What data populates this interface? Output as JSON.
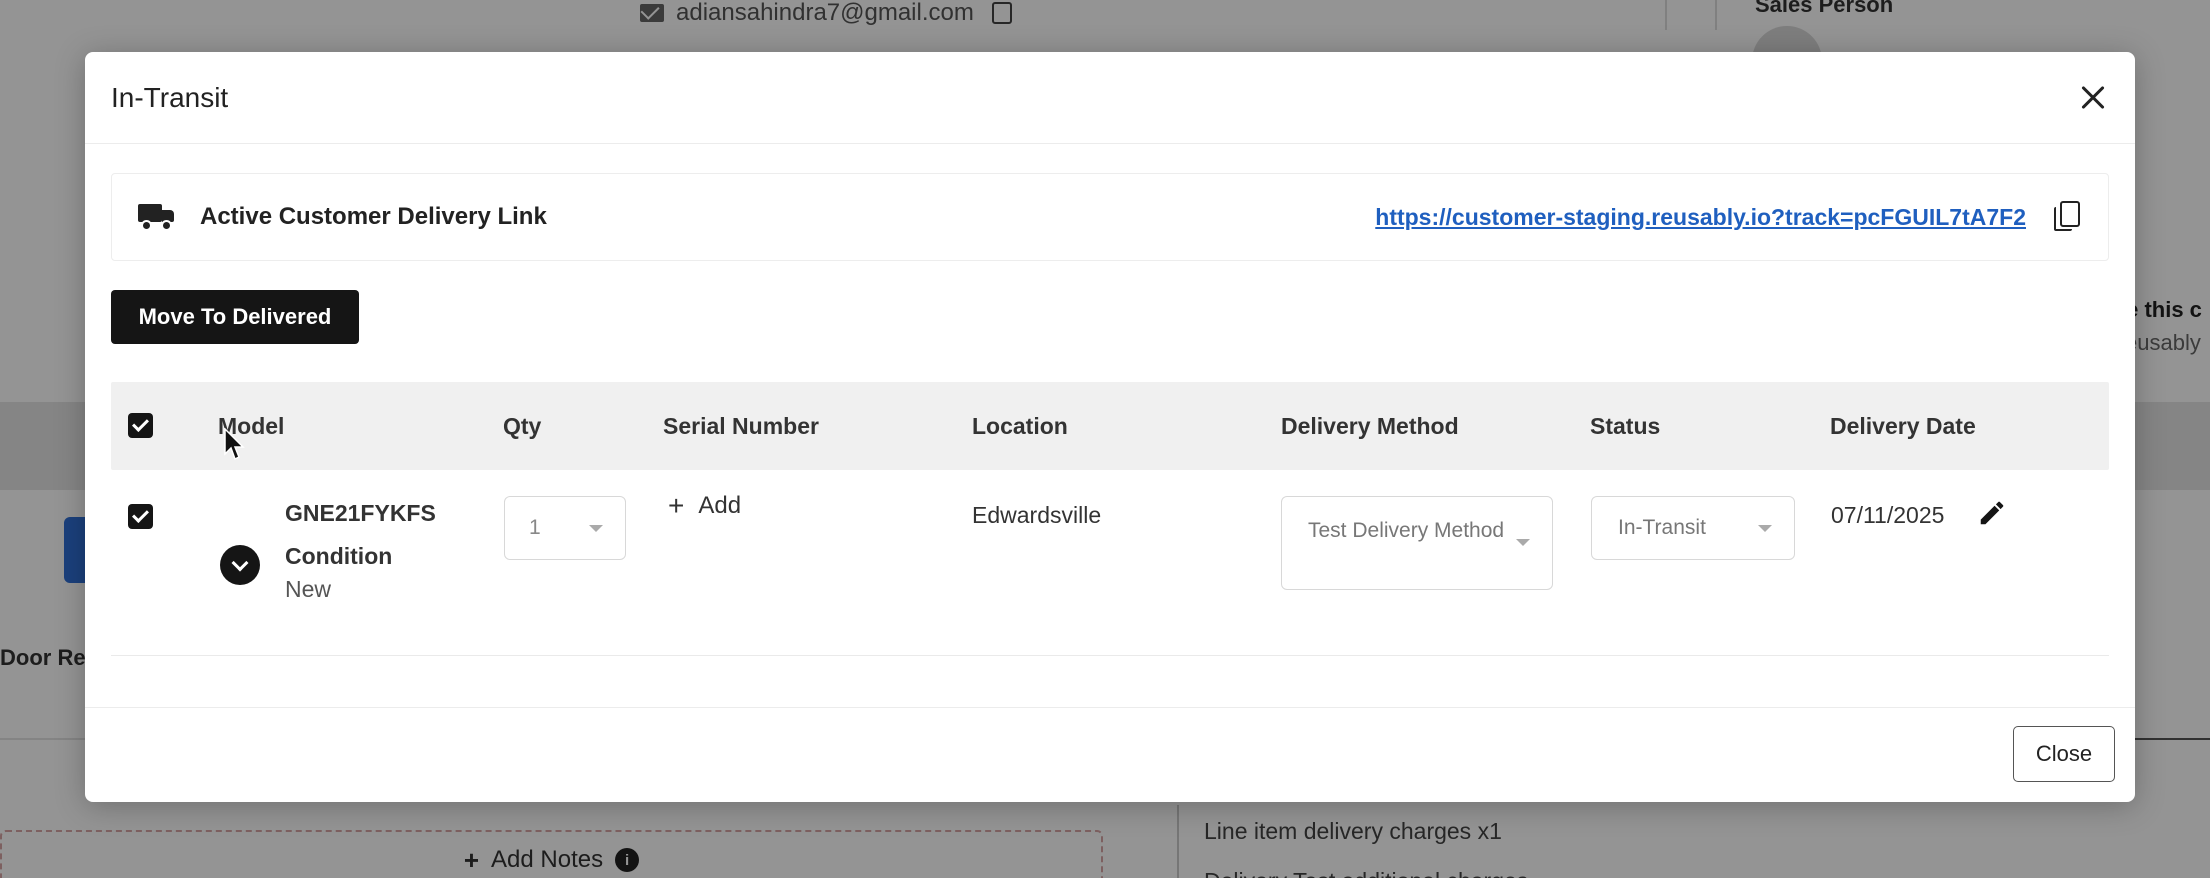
{
  "background": {
    "email": "adiansahindra7@gmail.com",
    "sales_person_label": "Sales Person",
    "right_text_1": "le this c",
    "right_text_2": "eusably",
    "door_label": "Door Ref",
    "add_notes_label": "Add Notes",
    "charges_line": "Line item delivery charges x1",
    "charges_line_2": "Delivery Test additional charges"
  },
  "modal": {
    "title": "In-Transit",
    "delivery_link_label": "Active Customer Delivery Link",
    "delivery_link_url": "https://customer-staging.reusably.io?track=pcFGUIL7tA7F2",
    "move_button_label": "Move To Delivered",
    "close_button_label": "Close"
  },
  "table": {
    "columns": [
      "Model",
      "Qty",
      "Serial Number",
      "Location",
      "Delivery Method",
      "Status",
      "Delivery Date"
    ],
    "rows": [
      {
        "model": "GNE21FYKFS",
        "condition_label": "Condition",
        "condition_value": "New",
        "qty": "1",
        "serial_add_label": "Add",
        "location": "Edwardsville",
        "delivery_method": "Test Delivery Method",
        "status": "In-Transit",
        "delivery_date": "07/11/2025"
      }
    ]
  },
  "colors": {
    "accent_dark": "#151515",
    "link_blue": "#1f5fbf",
    "header_gray": "#f0f0f0"
  },
  "icons": {
    "header_close": "close-icon",
    "truck": "truck-icon",
    "copy": "copy-icon",
    "expand": "chevron-down-icon",
    "edit": "pencil-icon"
  }
}
